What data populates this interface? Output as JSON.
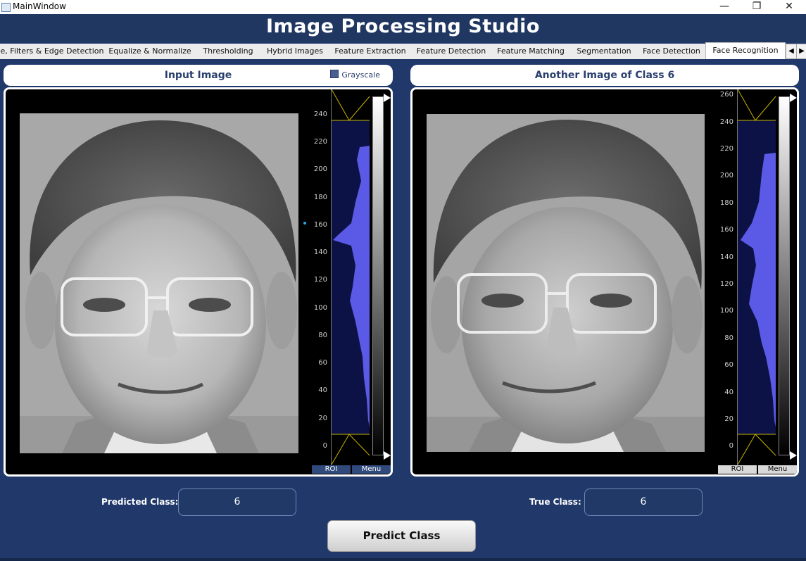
{
  "window": {
    "title": "MainWindow",
    "minimize_glyph": "—",
    "maximize_glyph": "❐",
    "close_glyph": "✕"
  },
  "app": {
    "title": "Image Processing Studio"
  },
  "tabs": [
    {
      "label": "e, Filters & Edge Detection"
    },
    {
      "label": "Equalize & Normalize"
    },
    {
      "label": "Thresholding"
    },
    {
      "label": "Hybrid Images"
    },
    {
      "label": "Feature Extraction"
    },
    {
      "label": "Feature Detection"
    },
    {
      "label": "Feature Matching"
    },
    {
      "label": "Segmentation"
    },
    {
      "label": "Face Detection"
    },
    {
      "label": "Face Recognition",
      "active": true
    }
  ],
  "tab_arrows": {
    "left": "◀",
    "right": "▶"
  },
  "left_panel": {
    "title": "Input Image",
    "grayscale_label": "Grayscale",
    "grayscale_checked": true,
    "histogram": {
      "tick_labels": [
        "240",
        "220",
        "200",
        "180",
        "160",
        "140",
        "120",
        "100",
        "80",
        "60",
        "40",
        "20",
        "0"
      ],
      "roi_label": "ROI",
      "menu_label": "Menu"
    }
  },
  "right_panel": {
    "title": "Another Image of Class 6",
    "histogram": {
      "tick_labels": [
        "260",
        "240",
        "220",
        "200",
        "180",
        "160",
        "140",
        "120",
        "100",
        "80",
        "60",
        "40",
        "20",
        "0"
      ],
      "roi_label": "ROI",
      "menu_label": "Menu"
    }
  },
  "predicted": {
    "label": "Predicted Class:",
    "value": "6"
  },
  "true_class": {
    "label": "True Class:",
    "value": "6"
  },
  "predict_button": {
    "label": "Predict Class"
  },
  "colors": {
    "background": "#20386a",
    "header": "#1f3761",
    "histogram_fill": "#5a5ae6",
    "histogram_bg": "#0d1246"
  },
  "icons": {
    "app": "app-window-icon",
    "checkbox": "grayscale-checkbox-icon"
  }
}
